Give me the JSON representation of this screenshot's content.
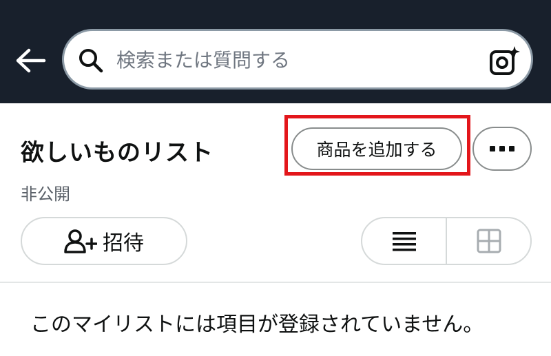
{
  "header": {
    "back_icon": "back-arrow-icon",
    "search": {
      "placeholder": "検索または質問する",
      "search_icon": "search-icon",
      "camera_icon": "camera-lens-icon"
    }
  },
  "list": {
    "title": "欲しいものリスト",
    "privacy": "非公開",
    "add_item_label": "商品を追加する",
    "more_icon": "more-dots-icon",
    "invite_label": "招待",
    "invite_icon": "add-user-icon",
    "view_modes": [
      "list-view-icon",
      "grid-view-icon"
    ],
    "empty_message": "このマイリストには項目が登録されていません。"
  },
  "colors": {
    "header_bg": "#18202c",
    "highlight": "#e3161b"
  }
}
